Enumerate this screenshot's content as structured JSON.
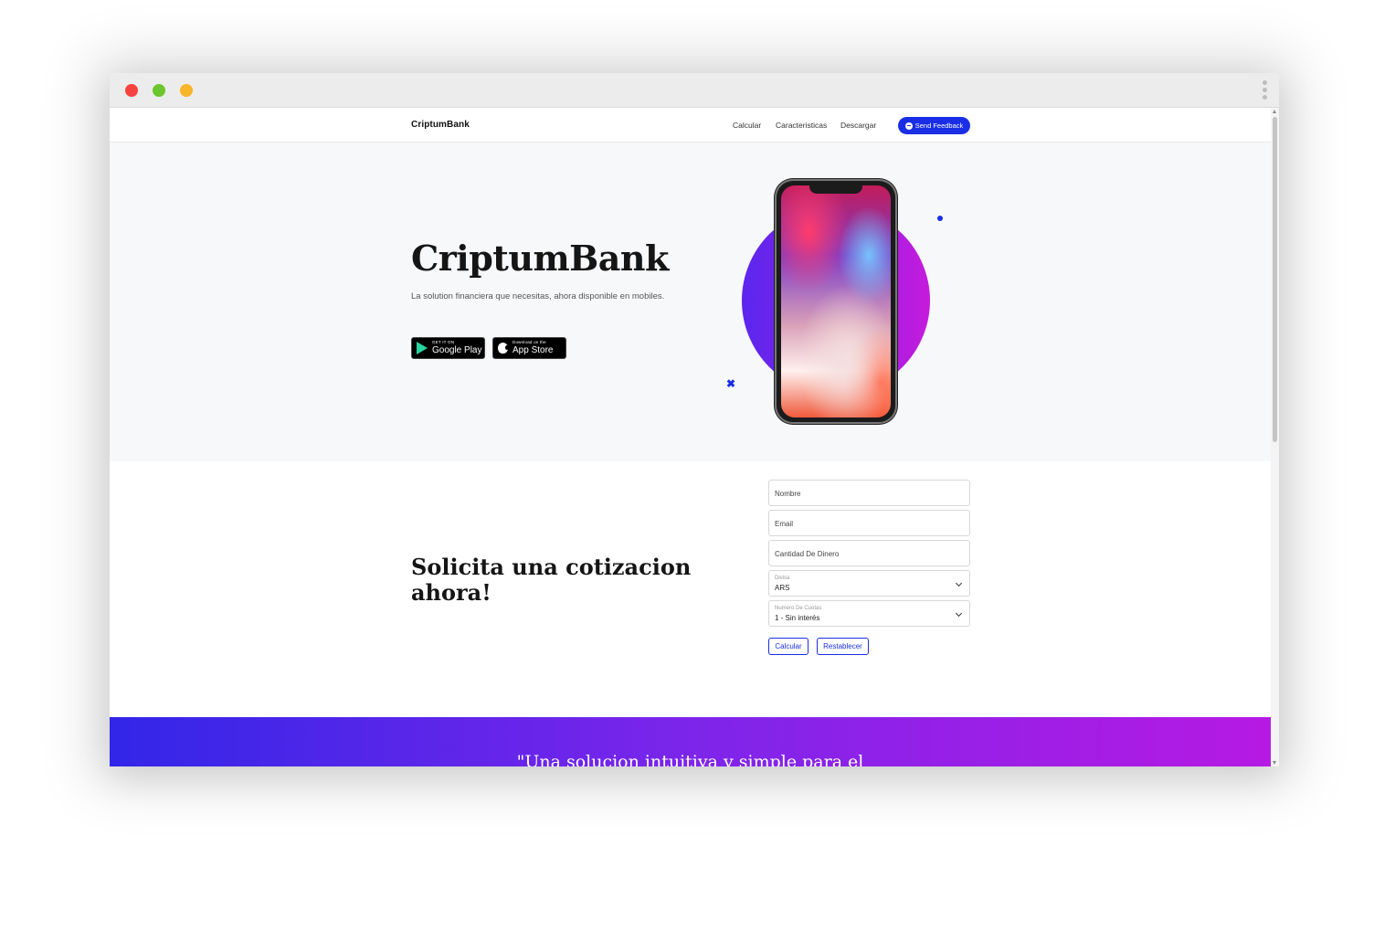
{
  "nav": {
    "brand": "CriptumBank",
    "links": [
      "Calcular",
      "Caracteristicas",
      "Descargar"
    ],
    "feedback_label": "Send Feedback"
  },
  "hero": {
    "title": "CriptumBank",
    "subtitle": "La solution financiera que necesitas, ahora disponible en mobiles.",
    "google_play": {
      "small": "GET IT ON",
      "big": "Google Play"
    },
    "app_store": {
      "small": "Download on the",
      "big": "App Store"
    }
  },
  "quote_form": {
    "title": "Solicita una cotizacion ahora!",
    "nombre_placeholder": "Nombre",
    "email_placeholder": "Email",
    "cantidad_placeholder": "Cantidad De Dinero",
    "divisa_label": "Divisa",
    "divisa_value": "ARS",
    "cuotas_label": "Numero De Cuotas",
    "cuotas_value": "1 - Sin interés",
    "calcular_label": "Calcular",
    "restablecer_label": "Restablecer"
  },
  "testimonial": {
    "quote": "\"Una solucion intuitiva y simple para el"
  },
  "colors": {
    "accent": "#1a2ee6",
    "gradient_start": "#3226e8",
    "gradient_end": "#b61ae3"
  }
}
